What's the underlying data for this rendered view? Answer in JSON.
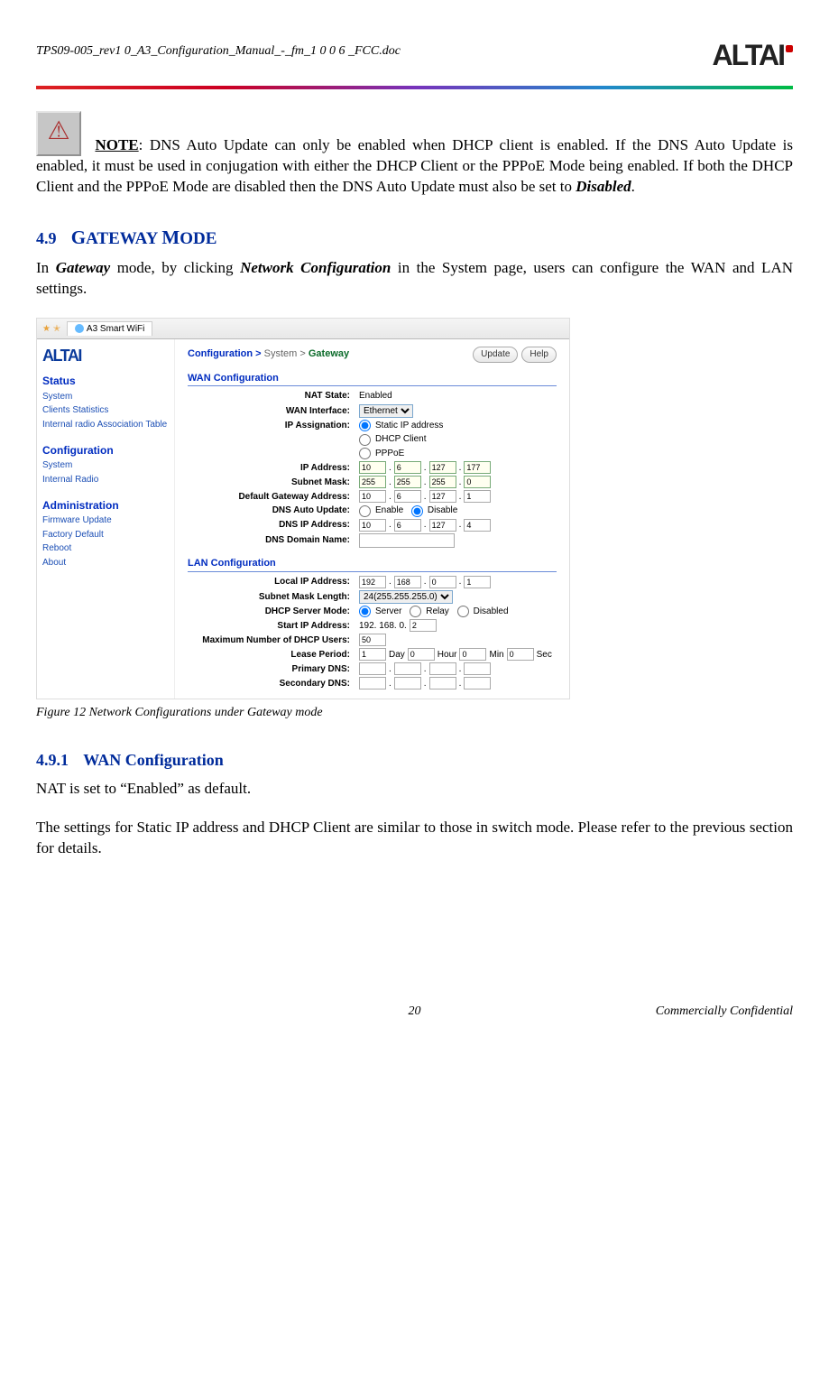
{
  "header": {
    "doc_id": "TPS09-005_rev1 0_A3_Configuration_Manual_-_fm_1 0 0 6 _FCC.doc",
    "logo": "ALTAI"
  },
  "note": {
    "label": "NOTE",
    "text": ": DNS Auto Update can only be enabled when DHCP client is enabled. If the DNS Auto Update is enabled, it must be used in conjugation with either the DHCP Client or the PPPoE Mode being enabled. If both the DHCP Client and the PPPoE Mode are disabled then the DNS Auto Update must also be set to ",
    "em": "Disabled",
    "tail": "."
  },
  "sec49": {
    "num": "4.9",
    "title": "Gateway Mode",
    "intro_a": "In ",
    "intro_em1": "Gateway",
    "intro_b": " mode, by clicking ",
    "intro_em2": "Network Configuration",
    "intro_c": " in the System page, users can configure the WAN and LAN settings."
  },
  "fig": {
    "tab_label": "A3 Smart WiFi",
    "breadcrumb": {
      "a": "Configuration >",
      "b": "System >",
      "c": "Gateway"
    },
    "btn_update": "Update",
    "btn_help": "Help",
    "sidebar": {
      "logo": "ALTAI",
      "status_h": "Status",
      "status": [
        "System",
        "Clients Statistics",
        "Internal radio Association Table"
      ],
      "config_h": "Configuration",
      "config": [
        "System",
        "Internal Radio"
      ],
      "admin_h": "Administration",
      "admin": [
        "Firmware Update",
        "Factory Default",
        "Reboot",
        "About"
      ]
    },
    "wan": {
      "title": "WAN Configuration",
      "nat_label": "NAT State:",
      "nat_value": "Enabled",
      "wif_label": "WAN Interface:",
      "wif_value": "Ethernet",
      "ipasg_label": "IP Assignation:",
      "ipasg_opts": [
        "Static IP address",
        "DHCP Client",
        "PPPoE"
      ],
      "ip_label": "IP Address:",
      "ip": [
        "10",
        "6",
        "127",
        "177"
      ],
      "mask_label": "Subnet Mask:",
      "mask": [
        "255",
        "255",
        "255",
        "0"
      ],
      "gw_label": "Default Gateway Address:",
      "gw": [
        "10",
        "6",
        "127",
        "1"
      ],
      "dnsau_label": "DNS Auto Update:",
      "dnsau_opts": [
        "Enable",
        "Disable"
      ],
      "dnsip_label": "DNS IP Address:",
      "dnsip": [
        "10",
        "6",
        "127",
        "4"
      ],
      "dnsname_label": "DNS Domain Name:"
    },
    "lan": {
      "title": "LAN Configuration",
      "lip_label": "Local IP Address:",
      "lip": [
        "192",
        "168",
        "0",
        "1"
      ],
      "mlen_label": "Subnet Mask Length:",
      "mlen_value": "24(255.255.255.0)",
      "dhcpm_label": "DHCP Server Mode:",
      "dhcpm_opts": [
        "Server",
        "Relay",
        "Disabled"
      ],
      "sip_label": "Start IP Address:",
      "sip_prefix": "192. 168. 0.",
      "sip_last": "2",
      "maxu_label": "Maximum Number of DHCP Users:",
      "maxu_value": "50",
      "lease_label": "Lease Period:",
      "lease": {
        "day": "1",
        "dayl": "Day",
        "hour": "0",
        "hourl": "Hour",
        "min": "0",
        "minl": "Min",
        "sec": "0",
        "secl": "Sec"
      },
      "pdns_label": "Primary DNS:",
      "sdns_label": "Secondary DNS:"
    }
  },
  "caption": "Figure 12     Network Configurations under Gateway mode",
  "sec491": {
    "num": "4.9.1",
    "title": "WAN Configuration",
    "p1": "NAT is set to “Enabled” as default.",
    "p2": "The settings for Static IP address and DHCP Client are similar to those in switch mode. Please refer to the previous section for details."
  },
  "footer": {
    "page": "20",
    "conf": "Commercially Confidential"
  }
}
